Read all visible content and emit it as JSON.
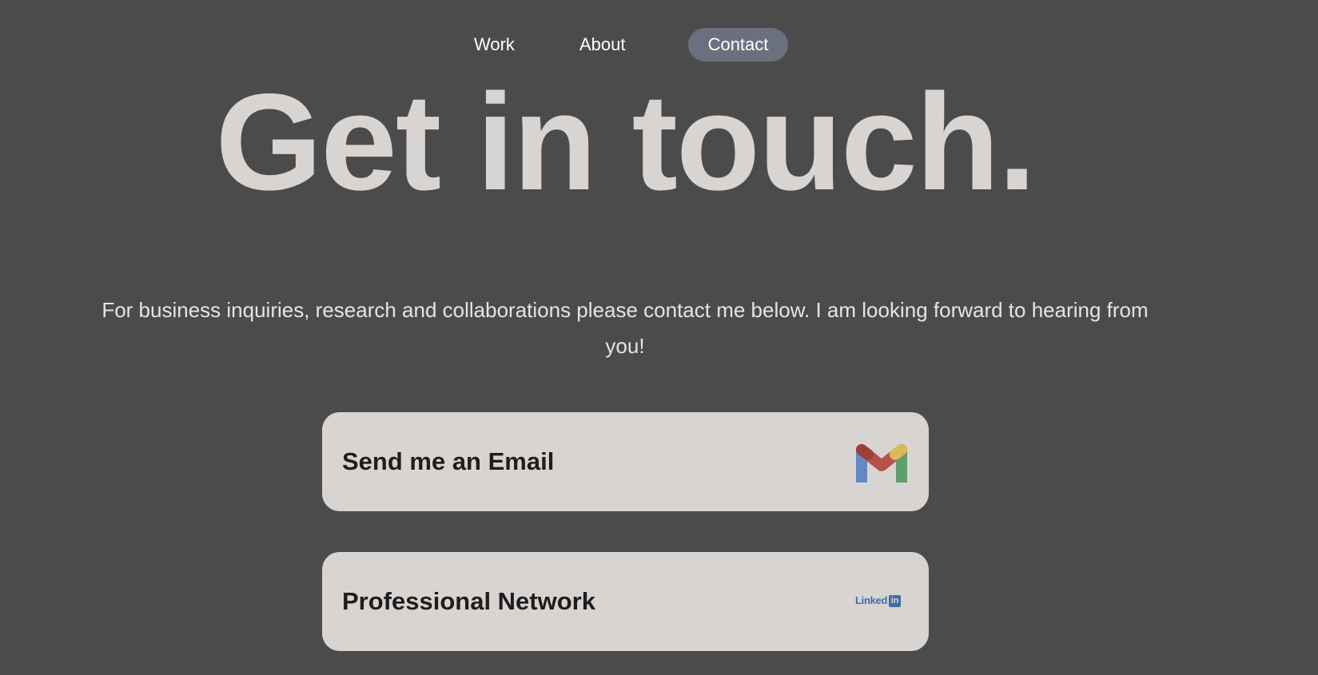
{
  "nav": {
    "items": [
      {
        "label": "Work"
      },
      {
        "label": "About"
      },
      {
        "label": "Contact",
        "active": true
      }
    ]
  },
  "hero": {
    "title": "Get in touch."
  },
  "intro": {
    "text": "For business inquiries, research and collaborations please contact me below. I am looking forward to hearing from you!"
  },
  "contact_cards": [
    {
      "label": "Send me an Email",
      "icon": "gmail-icon"
    },
    {
      "label": "Professional Network",
      "icon": "linkedin-icon",
      "icon_text": "Linked",
      "icon_badge": "in"
    }
  ],
  "colors": {
    "background": "#4b4b4b",
    "active_nav": "#6a707d",
    "card": "#d8d4d1",
    "hero_text": "#d8d4d2",
    "linkedin_blue": "#3f6ea0"
  }
}
